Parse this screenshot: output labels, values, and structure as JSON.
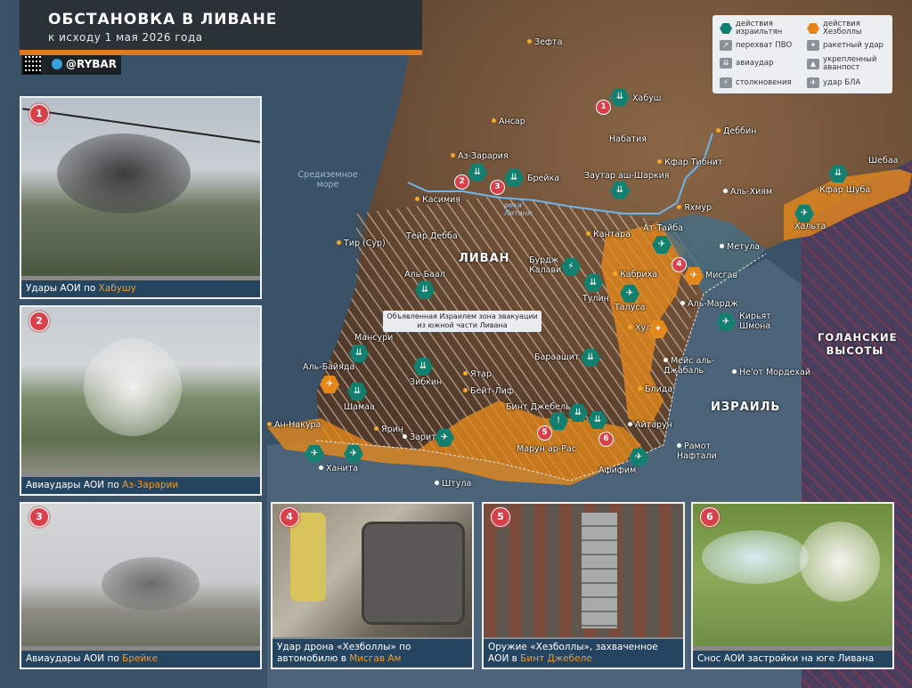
{
  "header": {
    "title": "ОБСТАНОВКА В ЛИВАНЕ",
    "subtitle": "к исходу 1 мая 2026 года",
    "brand": "@RYBAR"
  },
  "legend": {
    "items": [
      {
        "label": "действия израильтян"
      },
      {
        "label": "действия Хезболлы"
      },
      {
        "label": "перехват ПВО"
      },
      {
        "label": "ракетный удар"
      },
      {
        "label": "авиаудар"
      },
      {
        "label": "укрепленный аванпост"
      },
      {
        "label": "столкновения"
      },
      {
        "label": "удар БЛА"
      }
    ],
    "colors": {
      "israel": "#13806f",
      "hezbollah": "#e4881c",
      "neutral": "#8a9199"
    }
  },
  "panels": [
    {
      "num": "1",
      "caption_pre": "Удары АОИ по ",
      "caption_hl": "Хабушу",
      "caption_post": ""
    },
    {
      "num": "2",
      "caption_pre": "Авиаудары АОИ по ",
      "caption_hl": "Аз-Зарарии",
      "caption_post": ""
    },
    {
      "num": "3",
      "caption_pre": "Авиаудары АОИ по ",
      "caption_hl": "Брейке",
      "caption_post": ""
    },
    {
      "num": "4",
      "caption_pre": "Удар дрона «Хезболлы» по автомобилю в ",
      "caption_hl": "Мисгав Ам",
      "caption_post": ""
    },
    {
      "num": "5",
      "caption_pre": "Оружие «Хезболлы», захваченное АОИ в ",
      "caption_hl": "Бинт Джебеле",
      "caption_post": ""
    },
    {
      "num": "6",
      "caption_pre": "Снос АОИ застройки на юге Ливана",
      "caption_hl": "",
      "caption_post": ""
    }
  ],
  "map": {
    "regions": [
      "ЛИВАН",
      "ИЗРАИЛЬ",
      "ГОЛАНСКИЕ ВЫСОТЫ"
    ],
    "sea": "Средиземное море",
    "river": "река Литани",
    "evac_note": "Объявленная Израилем зона эвакуации из южной части Ливана",
    "places": [
      "Зефта",
      "Хабуш",
      "Ансар",
      "Набатия",
      "Деббин",
      "Аз-Зарария",
      "Брейка",
      "Заутар аш-Шаркия",
      "Кфар Тибнит",
      "Касимия",
      "Шебаа",
      "Аль-Хиям",
      "Кфар Шуба",
      "Хальта",
      "Яхмур",
      "Тир (Сур)",
      "Тейр Дебба",
      "Кантара",
      "Ат-Тайба",
      "Метула",
      "Бурдж Калави",
      "Кабриха",
      "Мисгав",
      "Аль-Баал",
      "Тулин",
      "Талуса",
      "Аль-Мардж",
      "Хула",
      "Кирьят Шмона",
      "Мансури",
      "Мейс аль-Джабаль",
      "Не'от Мордехай",
      "Бараашит",
      "Аль-Байяда",
      "Зибкин",
      "Ятар",
      "Шамаа",
      "Бейт-Лиф",
      "Бинт Джебель",
      "Блида",
      "Ан-Накура",
      "Ярин",
      "Зарит",
      "Марун ар-Рас",
      "Айтарун",
      "Рамот Нафтали",
      "Ханита",
      "Афифим",
      "Штула"
    ]
  }
}
